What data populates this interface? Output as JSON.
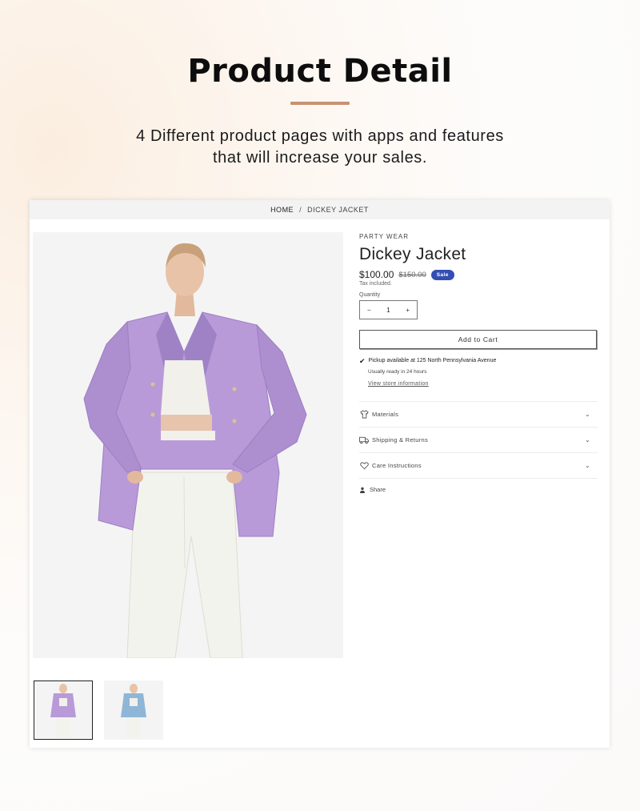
{
  "hero": {
    "title": "Product Detail",
    "subtitle_line1": "4 Different product pages with apps and features",
    "subtitle_line2": "that will increase your sales."
  },
  "breadcrumb": {
    "home": "HOME",
    "separator": "/",
    "current": "DICKEY JACKET"
  },
  "product": {
    "vendor": "PARTY WEAR",
    "title": "Dickey Jacket",
    "price": "$100.00",
    "compare_price": "$150.00",
    "badge": "Sale",
    "tax_note": "Tax included.",
    "quantity_label": "Quantity",
    "quantity_value": "1",
    "minus": "−",
    "plus": "+",
    "add_to_cart": "Add to Cart",
    "pickup_text": "Pickup available at 125 North Pennsylvania Avenue",
    "ready_text": "Usually ready in 24 hours",
    "store_link": "View store information"
  },
  "accordion": [
    {
      "label": "Materials",
      "icon": "shirt-icon"
    },
    {
      "label": "Shipping & Returns",
      "icon": "truck-icon"
    },
    {
      "label": "Care Instructions",
      "icon": "heart-icon"
    }
  ],
  "share_label": "Share",
  "colors": {
    "accent_divider": "#c99274",
    "sale_badge": "#334fb4",
    "jacket_purple": "#b89ad8",
    "jacket_blue": "#8fb6d6"
  }
}
